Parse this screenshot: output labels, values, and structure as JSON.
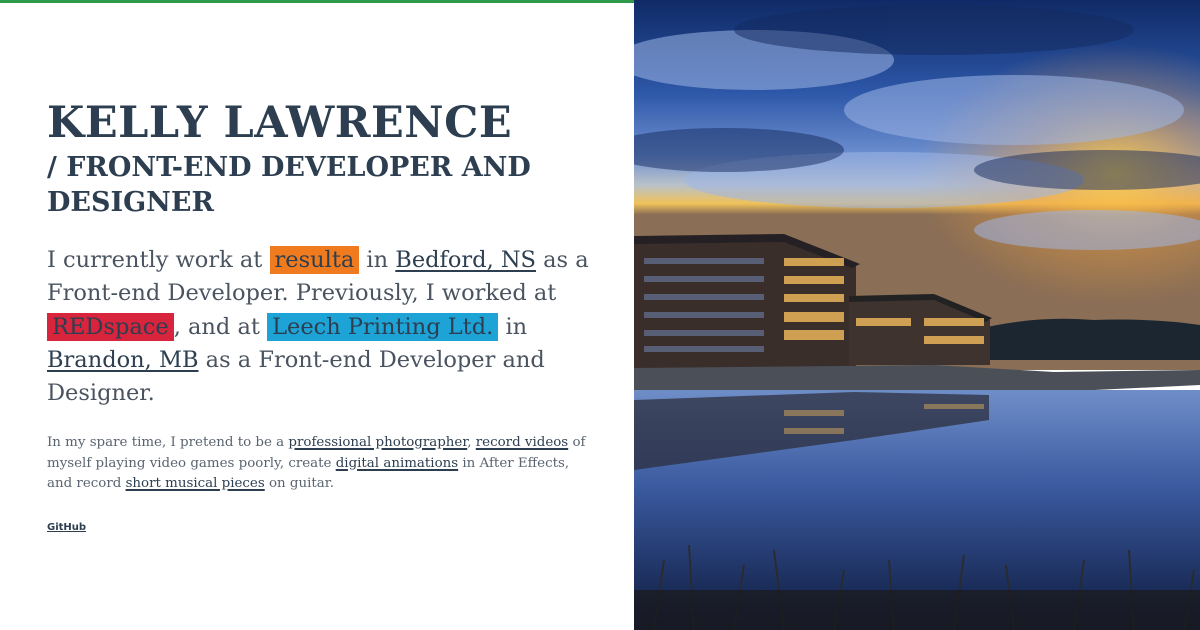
{
  "profile": {
    "name": "KELLY LAWRENCE",
    "role": "/ FRONT-END DEVELOPER AND DESIGNER"
  },
  "intro": {
    "t1": "I currently work at ",
    "company_current": "resulta",
    "t2": " in ",
    "location_current": "Bedford, NS",
    "t3": " as a Front-end Developer. Previously, I worked at ",
    "company_prev1": "REDspace",
    "t4": ", and at ",
    "company_prev2": "Leech Printing Ltd.",
    "t5": " in ",
    "location_prev": "Brandon, MB",
    "t6": " as a Front-end Developer and Designer."
  },
  "spare": {
    "t1": "In my spare time, I pretend to be a ",
    "link_photography": "professional photographer",
    "t2": ", ",
    "link_videos": "record videos",
    "t3": " of myself playing video games poorly, create ",
    "link_animations": "digital animations",
    "t4": " in After Effects, and record ",
    "link_music": "short musical pieces",
    "t5": " on guitar."
  },
  "links": {
    "github": "GitHub"
  },
  "colors": {
    "accent_bar": "#2e9a4a",
    "highlight_resulta": "#f07b1e",
    "highlight_redspace": "#d8243c",
    "highlight_leech": "#1ea3d6",
    "text": "#2c3e50"
  }
}
